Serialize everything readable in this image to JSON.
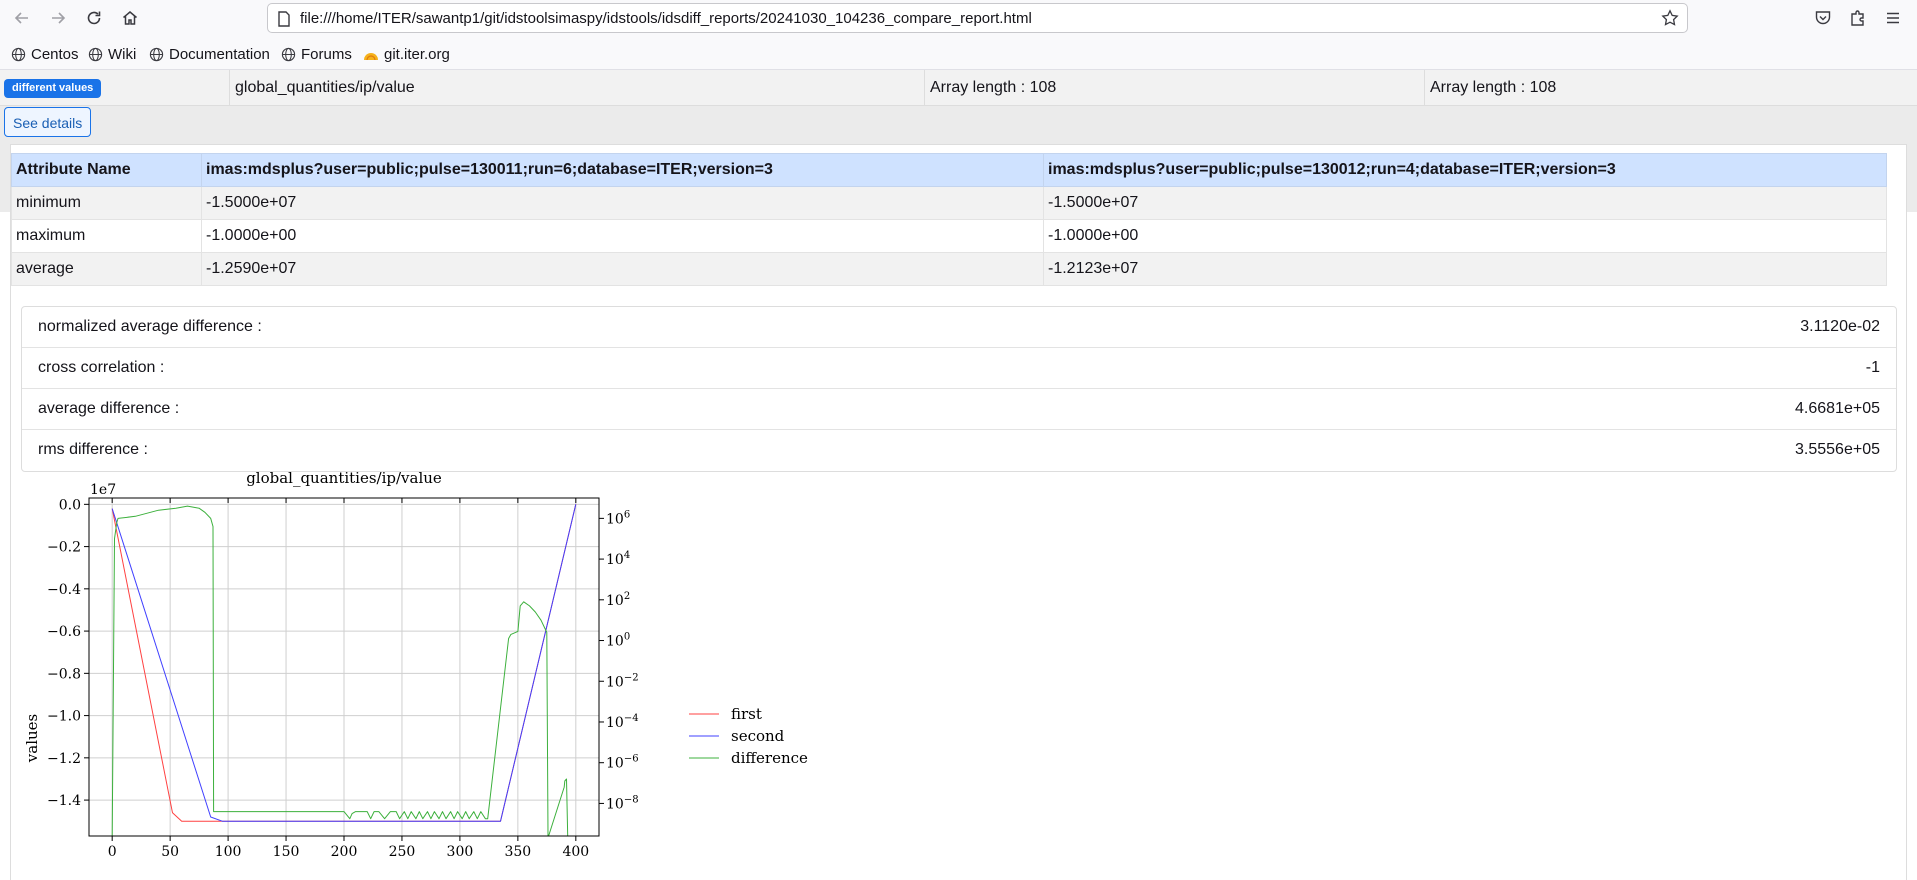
{
  "browser": {
    "url": "file:///home/ITER/sawantp1/git/idstoolsimaspy/idstools/idsdiff_reports/20241030_104236_compare_report.html"
  },
  "bookmarks": [
    "Centos",
    "Wiki",
    "Documentation",
    "Forums",
    "git.iter.org"
  ],
  "summary": {
    "badge": "different values",
    "path": "global_quantities/ip/value",
    "left_info": "Array length : 108",
    "right_info": "Array length : 108"
  },
  "see_details": "See details",
  "attr_table": {
    "headers": [
      "Attribute Name",
      "imas:mdsplus?user=public;pulse=130011;run=6;database=ITER;version=3",
      "imas:mdsplus?user=public;pulse=130012;run=4;database=ITER;version=3"
    ],
    "rows": [
      [
        "minimum",
        "-1.5000e+07",
        "-1.5000e+07"
      ],
      [
        "maximum",
        "-1.0000e+00",
        "-1.0000e+00"
      ],
      [
        "average",
        "-1.2590e+07",
        "-1.2123e+07"
      ]
    ]
  },
  "stats": [
    {
      "label": "normalized average difference :",
      "value": "3.1120e-02"
    },
    {
      "label": "cross correlation :",
      "value": "-1"
    },
    {
      "label": "average difference :",
      "value": "4.6681e+05"
    },
    {
      "label": "rms difference :",
      "value": "3.5556e+05"
    }
  ],
  "chart_data": {
    "type": "line",
    "title": "global_quantities/ip/value",
    "ylabel": "values",
    "y_offset_label": "1e7",
    "xlim": [
      -20,
      420
    ],
    "ylim": [
      -1.57,
      0.03
    ],
    "x_ticks": [
      0,
      50,
      100,
      150,
      200,
      250,
      300,
      350,
      400
    ],
    "y_ticks": [
      0.0,
      -0.2,
      -0.4,
      -0.6,
      -0.8,
      -1.0,
      -1.2,
      -1.4
    ],
    "y2_scale": "log",
    "y2_ticks": [
      "10^6",
      "10^4",
      "10^2",
      "10^0",
      "10^-2",
      "10^-4",
      "10^-6",
      "10^-8"
    ],
    "y2_exponents": [
      6,
      4,
      2,
      0,
      -2,
      -4,
      -6,
      -8
    ],
    "grid": true,
    "legend_position": "right",
    "series": [
      {
        "name": "first",
        "color": "#ff4040",
        "axis": "left",
        "x": [
          0,
          52,
          60,
          70,
          85,
          335,
          400
        ],
        "y": [
          -0.02,
          -1.46,
          -1.5,
          -1.5,
          -1.5,
          -1.5,
          0.0
        ]
      },
      {
        "name": "second",
        "color": "#4040ff",
        "axis": "left",
        "x": [
          0,
          85,
          95,
          335,
          400
        ],
        "y": [
          -0.02,
          -1.48,
          -1.5,
          -1.5,
          0.0
        ]
      },
      {
        "name": "difference",
        "color": "#3cb03c",
        "axis": "right",
        "x": [
          -1,
          0,
          2,
          4,
          5,
          20,
          40,
          55,
          65,
          75,
          80,
          85,
          87,
          87.5,
          200,
          205,
          207,
          210,
          215,
          220,
          223,
          226,
          230,
          235,
          240,
          245,
          248,
          252,
          255,
          258,
          262,
          265,
          268,
          272,
          275,
          278,
          282,
          285,
          288,
          292,
          295,
          298,
          302,
          305,
          308,
          312,
          315,
          318,
          322,
          324,
          342,
          344,
          350,
          352,
          355,
          360,
          365,
          370,
          375,
          376,
          376.5,
          390,
          390.5,
          392,
          393
        ],
        "y": [
          -9.6,
          -9.6,
          5.0,
          5.8,
          6.0,
          6.1,
          6.4,
          6.5,
          6.6,
          6.5,
          6.3,
          6.0,
          5.6,
          -8.4,
          -8.4,
          -8.75,
          -8.5,
          -8.4,
          -8.4,
          -8.4,
          -8.75,
          -8.4,
          -8.4,
          -8.75,
          -8.4,
          -8.4,
          -8.75,
          -8.4,
          -8.75,
          -8.4,
          -8.75,
          -8.4,
          -8.75,
          -8.4,
          -8.75,
          -8.4,
          -8.75,
          -8.4,
          -8.75,
          -8.4,
          -8.75,
          -8.4,
          -8.75,
          -8.4,
          -8.75,
          -8.4,
          -8.75,
          -8.4,
          -8.75,
          -8.75,
          0.1,
          0.3,
          0.45,
          1.7,
          1.9,
          1.7,
          1.4,
          1.0,
          0.4,
          -9.6,
          -9.6,
          -7.2,
          -6.9,
          -6.8,
          -9.6
        ]
      }
    ]
  }
}
